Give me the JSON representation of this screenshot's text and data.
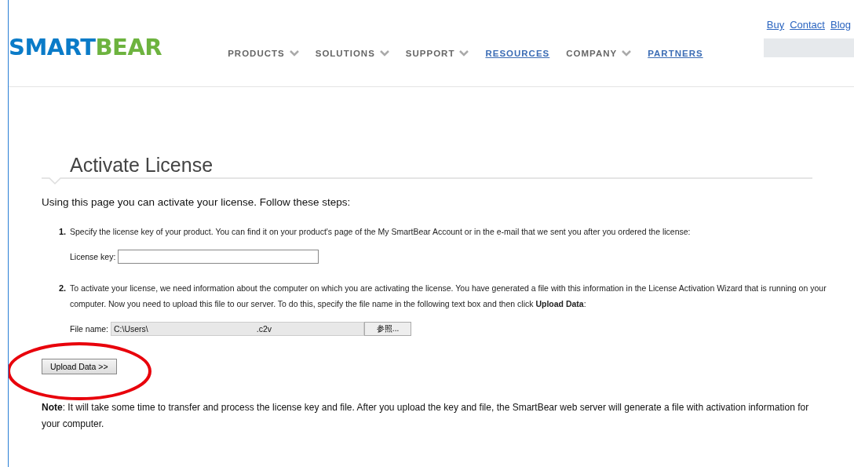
{
  "logo": {
    "part_1": "SMART",
    "part_2": "BEAR"
  },
  "top_links": [
    "Buy",
    "Contact",
    "Blog"
  ],
  "nav": [
    {
      "label": "PRODUCTS",
      "kind": "dropdown"
    },
    {
      "label": "SOLUTIONS",
      "kind": "dropdown"
    },
    {
      "label": "SUPPORT",
      "kind": "dropdown"
    },
    {
      "label": "RESOURCES",
      "kind": "link"
    },
    {
      "label": "COMPANY",
      "kind": "dropdown"
    },
    {
      "label": "PARTNERS",
      "kind": "link"
    }
  ],
  "title": "Activate License",
  "intro": "Using this page you can activate your license. Follow these steps:",
  "steps": [
    {
      "number": "1.",
      "text": "Specify the license key of your product. You can find it on your product's page of the My SmartBear Account or in the e-mail that we sent you after you ordered the license:",
      "field": {
        "kind": "text",
        "label": "License key:"
      }
    },
    {
      "number": "2.",
      "text": "To activate your license, we need information about the computer on which you are activating the license. You have generated a file with this information in the License Activation Wizard that is running on your computer. Now you need to upload this file to our server. To do this, specify the file name in the following text box and then click **Upload Data**:",
      "field": {
        "kind": "file",
        "label": "File name:",
        "value_start": "C:\\Users\\",
        "value_end": ".c2v",
        "browse": "参照..."
      }
    }
  ],
  "upload_button": "Upload Data >>",
  "note": "**Note**: It will take some time to transfer and process the license key and file. After you upload the key and file, the SmartBear web server will generate a file with activation information for your computer."
}
